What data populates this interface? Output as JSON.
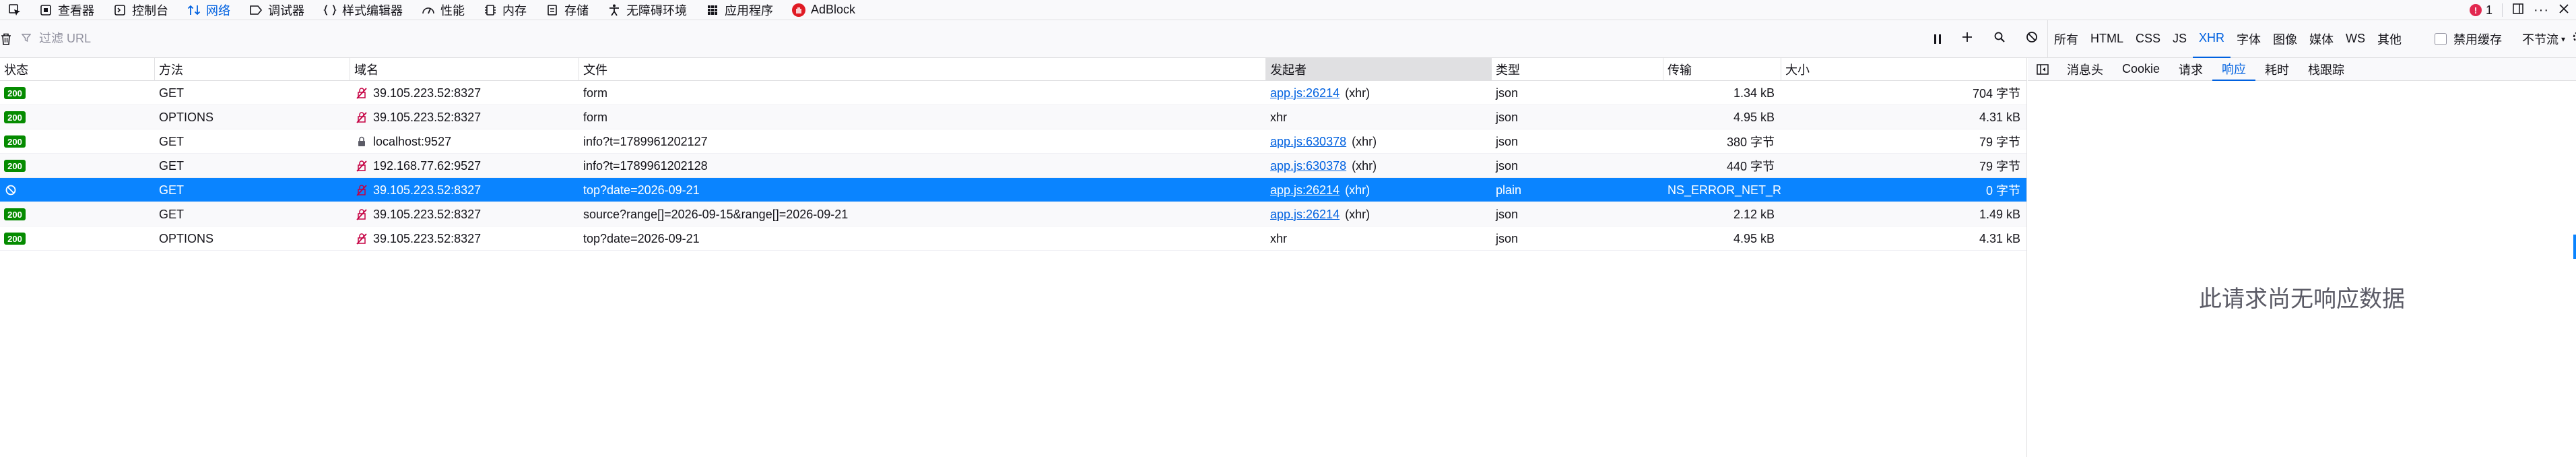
{
  "toolbox": {
    "tabs": [
      {
        "label": "查看器",
        "icon": "inspector-icon"
      },
      {
        "label": "控制台",
        "icon": "console-icon"
      },
      {
        "label": "网络",
        "icon": "network-icon",
        "active": true
      },
      {
        "label": "调试器",
        "icon": "debugger-icon"
      },
      {
        "label": "样式编辑器",
        "icon": "style-editor-icon"
      },
      {
        "label": "性能",
        "icon": "performance-icon"
      },
      {
        "label": "内存",
        "icon": "memory-icon"
      },
      {
        "label": "存储",
        "icon": "storage-icon"
      },
      {
        "label": "无障碍环境",
        "icon": "accessibility-icon"
      },
      {
        "label": "应用程序",
        "icon": "application-icon"
      },
      {
        "label": "AdBlock",
        "icon": "adblock-icon"
      }
    ],
    "error_count": "1"
  },
  "net_toolbar": {
    "filter_placeholder": "过滤 URL",
    "type_filters": [
      "所有",
      "HTML",
      "CSS",
      "JS",
      "XHR",
      "字体",
      "图像",
      "媒体",
      "WS",
      "其他"
    ],
    "active_type": "XHR",
    "disable_cache_label": "禁用缓存",
    "throttle_label": "不节流"
  },
  "columns": [
    "状态",
    "方法",
    "域名",
    "文件",
    "发起者",
    "类型",
    "传输",
    "大小"
  ],
  "requests": [
    {
      "status": "200",
      "method": "GET",
      "domain": "39.105.223.52:8327",
      "domain_icon": "insecure-icon",
      "file": "form",
      "initiator_link": "app.js:26214",
      "initiator_type": "(xhr)",
      "type": "json",
      "transferred": "1.34 kB",
      "size": "704 字节"
    },
    {
      "status": "200",
      "method": "OPTIONS",
      "domain": "39.105.223.52:8327",
      "domain_icon": "insecure-icon",
      "file": "form",
      "initiator_link": "",
      "initiator_type": "xhr",
      "type": "json",
      "transferred": "4.95 kB",
      "size": "4.31 kB"
    },
    {
      "status": "200",
      "method": "GET",
      "domain": "localhost:9527",
      "domain_icon": "lock-icon",
      "file": "info?t=1789961202127",
      "initiator_link": "app.js:630378",
      "initiator_type": "(xhr)",
      "type": "json",
      "transferred": "380 字节",
      "size": "79 字节"
    },
    {
      "status": "200",
      "method": "GET",
      "domain": "192.168.77.62:9527",
      "domain_icon": "insecure-icon",
      "file": "info?t=1789961202128",
      "initiator_link": "app.js:630378",
      "initiator_type": "(xhr)",
      "type": "json",
      "transferred": "440 字节",
      "size": "79 字节"
    },
    {
      "status": "blocked",
      "method": "GET",
      "domain": "39.105.223.52:8327",
      "domain_icon": "insecure-icon",
      "file": "top?date=2026-09-21",
      "initiator_link": "app.js:26214",
      "initiator_type": "(xhr)",
      "type": "plain",
      "transferred": "NS_ERROR_NET_R...",
      "size": "0 字节",
      "selected": true
    },
    {
      "status": "200",
      "method": "GET",
      "domain": "39.105.223.52:8327",
      "domain_icon": "insecure-icon",
      "file": "source?range[]=2026-09-15&range[]=2026-09-21",
      "initiator_link": "app.js:26214",
      "initiator_type": "(xhr)",
      "type": "json",
      "transferred": "2.12 kB",
      "size": "1.49 kB"
    },
    {
      "status": "200",
      "method": "OPTIONS",
      "domain": "39.105.223.52:8327",
      "domain_icon": "insecure-icon",
      "file": "top?date=2026-09-21",
      "initiator_link": "",
      "initiator_type": "xhr",
      "type": "json",
      "transferred": "4.95 kB",
      "size": "4.31 kB"
    }
  ],
  "side_panel": {
    "tabs": [
      "消息头",
      "Cookie",
      "请求",
      "响应",
      "耗时",
      "栈跟踪"
    ],
    "active_tab": "响应",
    "empty_message": "此请求尚无响应数据"
  },
  "colors": {
    "accent": "#0061e0",
    "selection": "#0a84ff",
    "status_ok": "#058b00"
  }
}
